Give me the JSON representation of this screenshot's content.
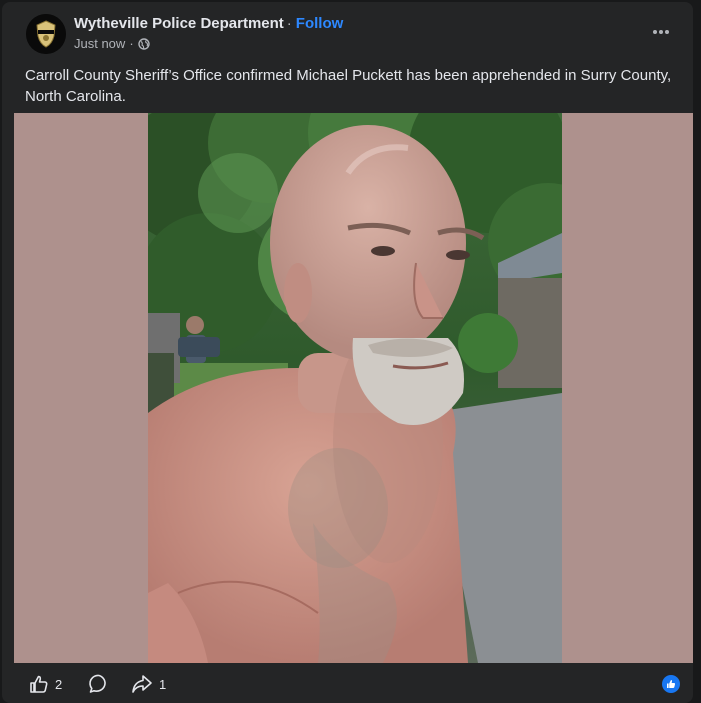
{
  "post": {
    "page_name": "Wytheville Police Department",
    "separator": "·",
    "follow_label": "Follow",
    "timestamp": "Just now",
    "meta_separator": "·",
    "privacy_icon": "globe-icon",
    "more_icon": "more-horizontal-icon",
    "caption": "Carroll County Sheriff’s Office confirmed Michael Puckett has been apprehended in Surry County, North Carolina."
  },
  "actions": {
    "like_count": "2",
    "share_count": "1",
    "icons": [
      "thumbs-up-icon",
      "comment-icon",
      "share-icon",
      "like-badge-icon"
    ]
  },
  "colors": {
    "card_bg": "#242526",
    "accent": "#2d88ff",
    "media_letterbox": "#ae918d",
    "like_blue": "#1877f2"
  }
}
